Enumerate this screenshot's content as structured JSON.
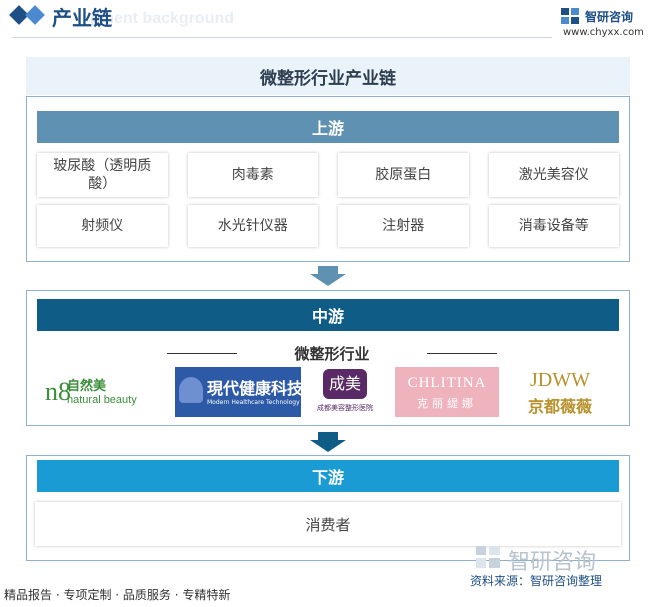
{
  "header": {
    "title": "产业链",
    "ghost_text": "pment background",
    "brand_cn": "智研咨询",
    "brand_url": "www.chyxx.com"
  },
  "diagram": {
    "title": "微整形行业产业链",
    "upstream": {
      "label": "上游",
      "items": [
        "玻尿酸（透明质酸）",
        "肉毒素",
        "胶原蛋白",
        "激光美容仪",
        "射频仪",
        "水光针仪器",
        "注射器",
        "消毒设备等"
      ]
    },
    "midstream": {
      "label": "中游",
      "industry": "微整形行业",
      "logos": [
        {
          "name": "自然美",
          "sub": "natural beauty",
          "mark": "n8",
          "color": "#3a8e3a"
        },
        {
          "name": "現代健康科技",
          "sub": "Modern Healthcare Technology",
          "color": "#2d5aa6"
        },
        {
          "name": "成美",
          "sub": "成都美容整形医院",
          "color": "#5a2a67"
        },
        {
          "name": "CHLITINA",
          "sub": "克丽缇娜",
          "color": "#efb3be"
        },
        {
          "name": "JDWW",
          "sub": "京都薇薇",
          "color": "#b8912c"
        }
      ]
    },
    "downstream": {
      "label": "下游",
      "item": "消费者"
    }
  },
  "footer": {
    "left": "精品报告 · 专项定制 · 品质服务 · 专精特新",
    "source": "资料来源：智研咨询整理",
    "brand": "智研咨询"
  },
  "colors": {
    "upstream_head": "#5f92b2",
    "midstream_head": "#0f5d86",
    "downstream_head": "#1a9bd4",
    "brand": "#1e4f86"
  }
}
